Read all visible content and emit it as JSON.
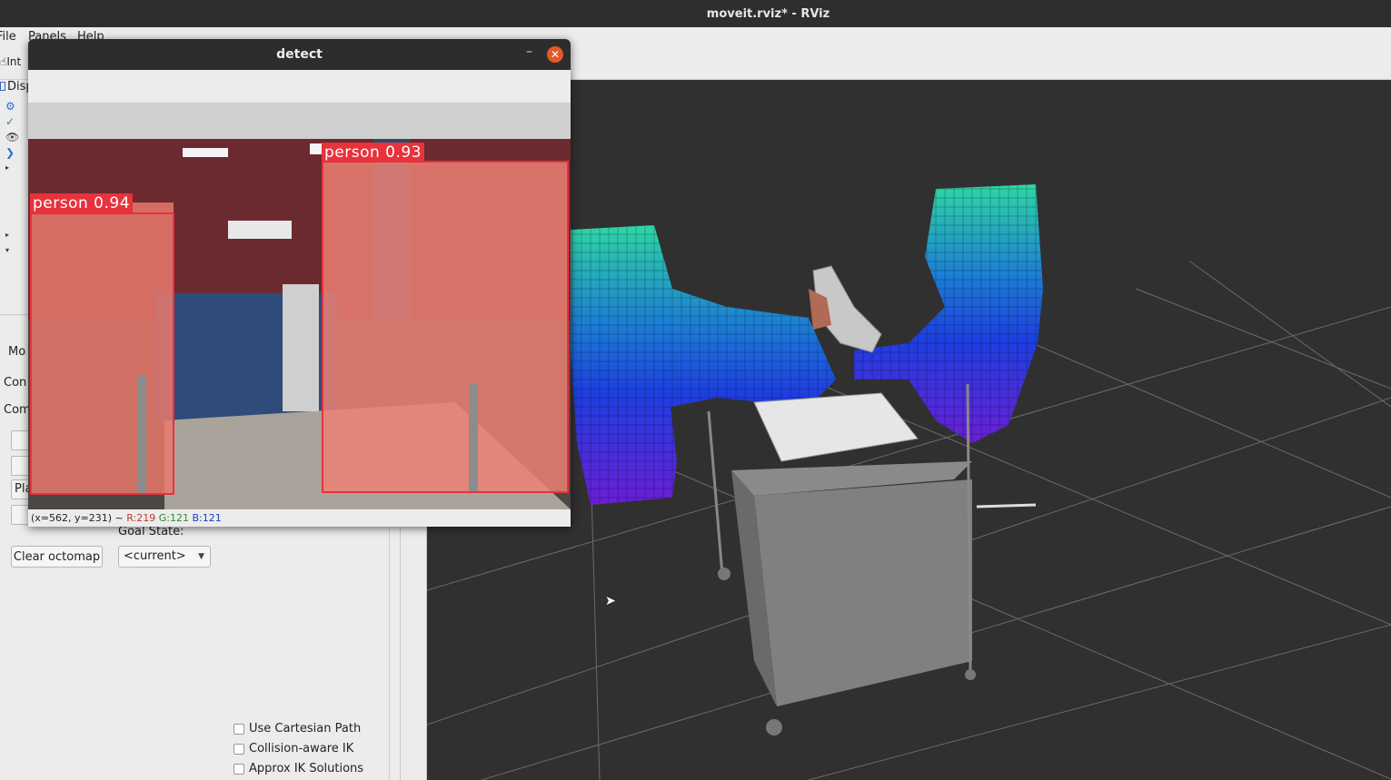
{
  "window": {
    "title": "moveit.rviz* - RViz"
  },
  "menu": {
    "file": "File",
    "panels": "Panels",
    "help": "Help"
  },
  "toolbar": {
    "interact": "Int"
  },
  "displays": {
    "header": "Disp"
  },
  "motion_panel": {
    "tab": "Mo",
    "context_tab": "Con",
    "commands_label": "Com",
    "plan_stub": "Pla",
    "goal_state_label": "Goal State:",
    "goal_state_value": "<current>",
    "clear_octomap": "Clear octomap",
    "options": [
      {
        "label": "Use Cartesian Path",
        "checked": false
      },
      {
        "label": "Collision-aware IK",
        "checked": false
      },
      {
        "label": "Approx IK Solutions",
        "checked": false
      }
    ]
  },
  "detect_window": {
    "title": "detect",
    "minimize": "–",
    "close": "✕",
    "detections": [
      {
        "label": "person 0.94"
      },
      {
        "label": "person 0.93"
      }
    ],
    "status": {
      "coords": "(x=562, y=231) ~",
      "r": "R:219",
      "g": "G:121",
      "b": "B:121"
    }
  },
  "colors": {
    "accent_close": "#e25a29",
    "bbox": "#e8323c"
  }
}
